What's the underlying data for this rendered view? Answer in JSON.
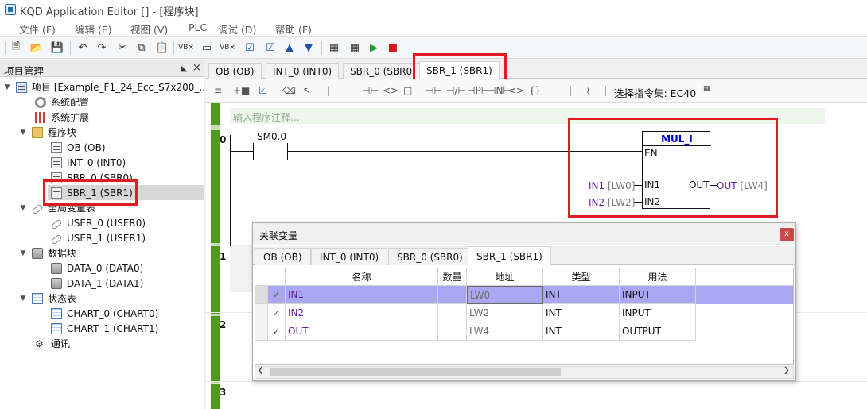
{
  "window": {
    "title": "KQD Application Editor [] - [程序块]"
  },
  "menu": [
    "文件 (F)",
    "编辑 (E)",
    "视图 (V)",
    "PLC",
    "调试 (D)",
    "帮助 (F)"
  ],
  "left_panel": {
    "title": "项目管理",
    "tree": [
      {
        "label": "项目 [Example_F1_24_Ecc_S7x200_...",
        "icon": "computer-icon"
      },
      {
        "label": "系统配置",
        "icon": "gear-icon"
      },
      {
        "label": "系统扩展",
        "icon": "grid-icon"
      },
      {
        "label": "程序块",
        "icon": "folder-icon"
      },
      {
        "label": "OB (OB)",
        "icon": "pou-icon"
      },
      {
        "label": "INT_0 (INT0)",
        "icon": "pou-icon"
      },
      {
        "label": "SBR_0 (SBR0)",
        "icon": "pou-icon"
      },
      {
        "label": "SBR_1 (SBR1)",
        "icon": "pou-icon"
      },
      {
        "label": "全局变量表",
        "icon": "tag-icon"
      },
      {
        "label": "USER_0 (USER0)",
        "icon": "tag-icon"
      },
      {
        "label": "USER_1 (USER1)",
        "icon": "tag-icon"
      },
      {
        "label": "数据块",
        "icon": "database-icon"
      },
      {
        "label": "DATA_0 (DATA0)",
        "icon": "database-icon"
      },
      {
        "label": "DATA_1 (DATA1)",
        "icon": "database-icon"
      },
      {
        "label": "状态表",
        "icon": "chart-icon"
      },
      {
        "label": "CHART_0 (CHART0)",
        "icon": "chart-icon"
      },
      {
        "label": "CHART_1 (CHART1)",
        "icon": "chart-icon"
      },
      {
        "label": "通讯",
        "icon": "plug-icon"
      }
    ]
  },
  "tabs": [
    "OB (OB)",
    "INT_0 (INT0)",
    "SBR_0 (SBR0)",
    "SBR_1 (SBR1)"
  ],
  "active_tab": "SBR_1 (SBR1)",
  "edit_toolbar": {
    "instruction_set_label": "选择指令集: EC40"
  },
  "editor": {
    "comment_placeholder": "输入程序注释...",
    "networks": [
      "0",
      "1",
      "2",
      "3"
    ],
    "contact": "SM0.0",
    "block": {
      "title": "MUL_I",
      "en": "EN",
      "in1_pin": "IN1",
      "in2_pin": "IN2",
      "out_pin": "OUT",
      "in1_var": "IN1",
      "in1_addr": "[LW0]",
      "in2_var": "IN2",
      "in2_addr": "[LW2]",
      "out_var": "OUT",
      "out_addr": "[LW4]"
    }
  },
  "dialog": {
    "title": "关联变量",
    "close_label": "x",
    "tabs": [
      "OB (OB)",
      "INT_0 (INT0)",
      "SBR_0 (SBR0)",
      "SBR_1 (SBR1)"
    ],
    "active_tab": "SBR_1 (SBR1)",
    "columns": [
      "名称",
      "数量",
      "地址",
      "类型",
      "用法"
    ],
    "rows": [
      {
        "check": "✓",
        "name": "IN1",
        "count": "",
        "address": "LW0",
        "type": "INT",
        "usage": "INPUT",
        "selected": true
      },
      {
        "check": "✓",
        "name": "IN2",
        "count": "",
        "address": "LW2",
        "type": "INT",
        "usage": "INPUT",
        "selected": false
      },
      {
        "check": "✓",
        "name": "OUT",
        "count": "",
        "address": "LW4",
        "type": "INT",
        "usage": "OUTPUT",
        "selected": false
      }
    ]
  },
  "colors": {
    "highlight": "#e01b24",
    "network_bar": "#4e9a1f",
    "selection": "#a9a7f0",
    "block_title": "#0000c8"
  }
}
